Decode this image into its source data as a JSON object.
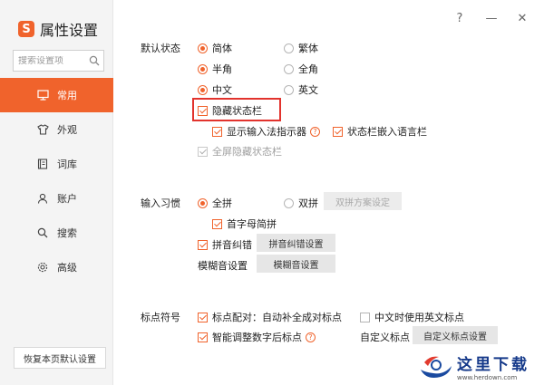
{
  "app": {
    "title": "属性设置",
    "logo_char": "S"
  },
  "search": {
    "placeholder": "搜索设置项"
  },
  "nav": [
    {
      "label": "常用",
      "icon": "monitor-icon",
      "active": true
    },
    {
      "label": "外观",
      "icon": "shirt-icon",
      "active": false
    },
    {
      "label": "词库",
      "icon": "book-icon",
      "active": false
    },
    {
      "label": "账户",
      "icon": "user-icon",
      "active": false
    },
    {
      "label": "搜索",
      "icon": "search-icon",
      "active": false
    },
    {
      "label": "高级",
      "icon": "gear-icon",
      "active": false
    }
  ],
  "restore_label": "恢复本页默认设置",
  "window": {
    "help": "?",
    "minimize": "—",
    "close": "✕"
  },
  "default_state": {
    "label": "默认状态",
    "simplified": "简体",
    "traditional": "繁体",
    "half_width": "半角",
    "full_width": "全角",
    "chinese": "中文",
    "english": "英文",
    "hide_status_bar": "隐藏状态栏",
    "show_indicator": "显示输入法指示器",
    "embed_language_bar": "状态栏嵌入语言栏",
    "fullscreen_hide": "全屏隐藏状态栏"
  },
  "input_habit": {
    "label": "输入习惯",
    "full_pinyin": "全拼",
    "double_pinyin": "双拼",
    "double_scheme_button": "双拼方案设定",
    "initial_abbrev": "首字母简拼",
    "pinyin_correction": "拼音纠错",
    "pinyin_correction_button": "拼音纠错设置",
    "fuzzy_label": "模糊音设置",
    "fuzzy_button": "模糊音设置"
  },
  "punctuation": {
    "label": "标点符号",
    "auto_pair": "标点配对：自动补全成对标点",
    "english_punct": "中文时使用英文标点",
    "smart_adjust": "智能调整数字后标点",
    "custom_label": "自定义标点",
    "custom_button": "自定义标点设置"
  },
  "watermark": {
    "title": "这里下载",
    "url": "www.herdown.com"
  },
  "colors": {
    "accent": "#f0632c",
    "highlight": "#e2332d",
    "sidebar_bg": "#f4f4f4"
  }
}
